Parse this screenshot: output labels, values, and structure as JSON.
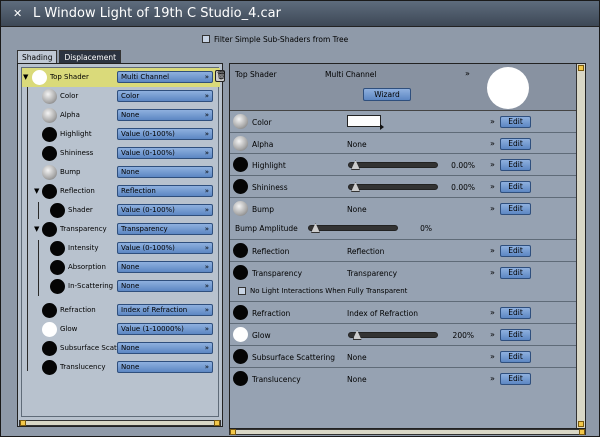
{
  "window": {
    "title": "L Window Light of 19th C Studio_4.car",
    "close_glyph": "✕"
  },
  "filter": {
    "label": "Filter Simple Sub-Shaders from Tree",
    "checked": false
  },
  "tabs": [
    {
      "label": "Shading",
      "active": true
    },
    {
      "label": "Displacement",
      "active": false
    }
  ],
  "tree": {
    "items": [
      {
        "label": "Top Shader",
        "dropdown": "Multi Channel",
        "ball": "white"
      },
      {
        "label": "Color",
        "dropdown": "Color",
        "ball": "grey"
      },
      {
        "label": "Alpha",
        "dropdown": "None",
        "ball": "grey"
      },
      {
        "label": "Highlight",
        "dropdown": "Value (0-100%)",
        "ball": "black"
      },
      {
        "label": "Shininess",
        "dropdown": "Value (0-100%)",
        "ball": "black"
      },
      {
        "label": "Bump",
        "dropdown": "None",
        "ball": "grey"
      },
      {
        "label": "Reflection",
        "dropdown": "Reflection",
        "ball": "black"
      },
      {
        "label": "Shader",
        "dropdown": "Value (0-100%)",
        "ball": "black"
      },
      {
        "label": "Transparency",
        "dropdown": "Transparency",
        "ball": "black"
      },
      {
        "label": "Intensity",
        "dropdown": "Value (0-100%)",
        "ball": "black"
      },
      {
        "label": "Absorption",
        "dropdown": "None",
        "ball": "black"
      },
      {
        "label": "In-Scattering",
        "dropdown": "None",
        "ball": "black"
      },
      {
        "label": "Refraction",
        "dropdown": "Index of Refraction",
        "ball": "black"
      },
      {
        "label": "Glow",
        "dropdown": "Value (1-10000%)",
        "ball": "white"
      },
      {
        "label": "Subsurface Scat",
        "dropdown": "None",
        "ball": "black"
      },
      {
        "label": "Translucency",
        "dropdown": "None",
        "ball": "black"
      }
    ]
  },
  "props": {
    "header": {
      "label": "Top Shader",
      "value": "Multi Channel",
      "wizard": "Wizard"
    },
    "edit_label": "Edit",
    "chevron": "»",
    "rows": {
      "color": {
        "name": "Color"
      },
      "alpha": {
        "name": "Alpha",
        "value": "None"
      },
      "highlight": {
        "name": "Highlight",
        "value": "0.00%",
        "level": 0.0
      },
      "shininess": {
        "name": "Shininess",
        "value": "0.00%",
        "level": 0.0
      },
      "bump": {
        "name": "Bump",
        "value": "None"
      },
      "bump_amp": {
        "name": "Bump Amplitude",
        "value": "0%",
        "level": 0.0
      },
      "reflection": {
        "name": "Reflection",
        "value": "Reflection"
      },
      "transparency": {
        "name": "Transparency",
        "value": "Transparency"
      },
      "no_light": {
        "label": "No Light Interactions When Fully Transparent",
        "checked": false
      },
      "refraction": {
        "name": "Refraction",
        "value": "Index of Refraction"
      },
      "glow": {
        "name": "Glow",
        "value": "200%",
        "level": 0.02
      },
      "subsurface": {
        "name": "Subsurface Scattering",
        "value": "None"
      },
      "translucency": {
        "name": "Translucency",
        "value": "None"
      }
    }
  },
  "colors": {
    "window_bg": "#8f9aa9",
    "dropdown_blue": "#6f96d0",
    "selected_row": "#dada7a",
    "handle_yellow": "#f3c84a"
  }
}
